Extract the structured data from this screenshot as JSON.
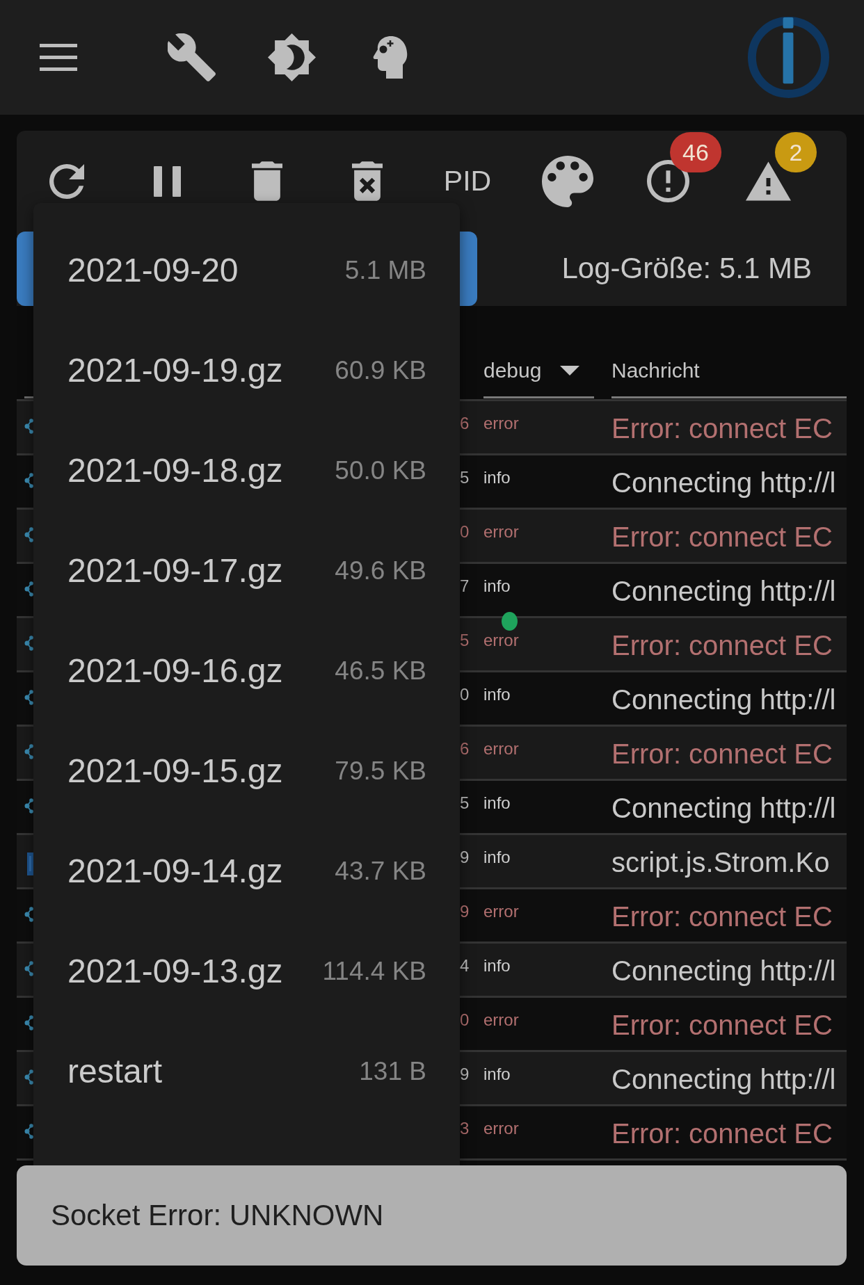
{
  "toolbar": {
    "pid_button": "PID",
    "badges": [
      {
        "count": "46",
        "color": "#c0352f"
      },
      {
        "count": "2",
        "color": "#c99a12"
      }
    ]
  },
  "log_size": "Log-Größe: 5.1 MB",
  "file_menu": {
    "items": [
      {
        "name": "2021-09-20",
        "size": "5.1 MB"
      },
      {
        "name": "2021-09-19.gz",
        "size": "60.9 KB"
      },
      {
        "name": "2021-09-18.gz",
        "size": "50.0 KB"
      },
      {
        "name": "2021-09-17.gz",
        "size": "49.6 KB"
      },
      {
        "name": "2021-09-16.gz",
        "size": "46.5 KB"
      },
      {
        "name": "2021-09-15.gz",
        "size": "79.5 KB"
      },
      {
        "name": "2021-09-14.gz",
        "size": "43.7 KB"
      },
      {
        "name": "2021-09-13.gz",
        "size": "114.4 KB"
      },
      {
        "name": "restart",
        "size": "131 B"
      }
    ]
  },
  "log_table": {
    "filters": [
      {
        "kind": "select",
        "value": "debug"
      },
      {
        "kind": "text",
        "placeholder": "Nachricht"
      }
    ],
    "rows": [
      {
        "kind": "error",
        "source": {
          "kind": "adapter"
        },
        "column_2": "6",
        "severity": "error",
        "message": "Error: connect EC"
      },
      {
        "kind": "info",
        "source": {
          "kind": "adapter"
        },
        "column_2": "5",
        "severity": "info",
        "message": "Connecting http://l"
      },
      {
        "kind": "error",
        "source": {
          "kind": "adapter"
        },
        "column_2": "0",
        "severity": "error",
        "message": "Error: connect EC"
      },
      {
        "kind": "info",
        "source": {
          "kind": "adapter"
        },
        "column_2": "7",
        "severity": "info",
        "message": "Connecting http://l"
      },
      {
        "kind": "error",
        "source": {
          "kind": "adapter"
        },
        "column_2": "5",
        "severity": "error",
        "message": "Error: connect EC"
      },
      {
        "kind": "info",
        "source": {
          "kind": "adapter"
        },
        "column_2": "0",
        "severity": "info",
        "message": "Connecting http://l"
      },
      {
        "kind": "error",
        "source": {
          "kind": "adapter"
        },
        "column_2": "6",
        "severity": "error",
        "message": "Error: connect EC"
      },
      {
        "kind": "info",
        "source": {
          "kind": "adapter"
        },
        "column_2": "5",
        "severity": "info",
        "message": "Connecting http://l"
      },
      {
        "kind": "info",
        "source": {
          "kind": "script"
        },
        "column_2": "9",
        "severity": "info",
        "message": "script.js.Strom.Ko"
      },
      {
        "kind": "error",
        "source": {
          "kind": "adapter"
        },
        "column_2": "9",
        "severity": "error",
        "message": "Error: connect EC"
      },
      {
        "kind": "info",
        "source": {
          "kind": "adapter"
        },
        "column_2": "4",
        "severity": "info",
        "message": "Connecting http://l"
      },
      {
        "kind": "error",
        "source": {
          "kind": "adapter"
        },
        "column_2": "0",
        "severity": "error",
        "message": "Error: connect EC"
      },
      {
        "kind": "info",
        "source": {
          "kind": "adapter"
        },
        "column_2": "9",
        "severity": "info",
        "message": "Connecting http://l"
      },
      {
        "kind": "error",
        "source": {
          "kind": "adapter"
        },
        "column_2": "3",
        "severity": "error",
        "message": "Error: connect EC"
      }
    ]
  },
  "snackbar": {
    "message": "Socket Error: UNKNOWN"
  }
}
